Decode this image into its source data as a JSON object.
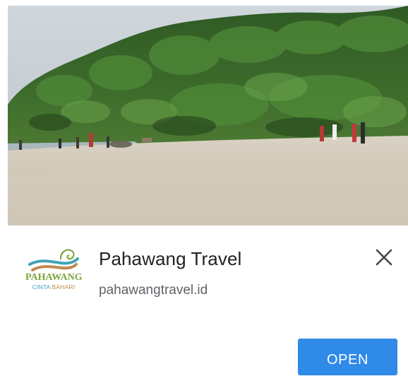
{
  "ad": {
    "image": {
      "description_icon": "beach-photo"
    },
    "logo": {
      "word": "PAHAWANG",
      "sub_part1": "CINTA",
      "sub_part2": "BAHARI"
    },
    "title": "Pahawang Travel",
    "domain": "pahawangtravel.id",
    "open_label": "OPEN"
  },
  "colors": {
    "accent": "#2f8ae8",
    "title_text": "#222222",
    "domain_text": "#5f6368"
  }
}
